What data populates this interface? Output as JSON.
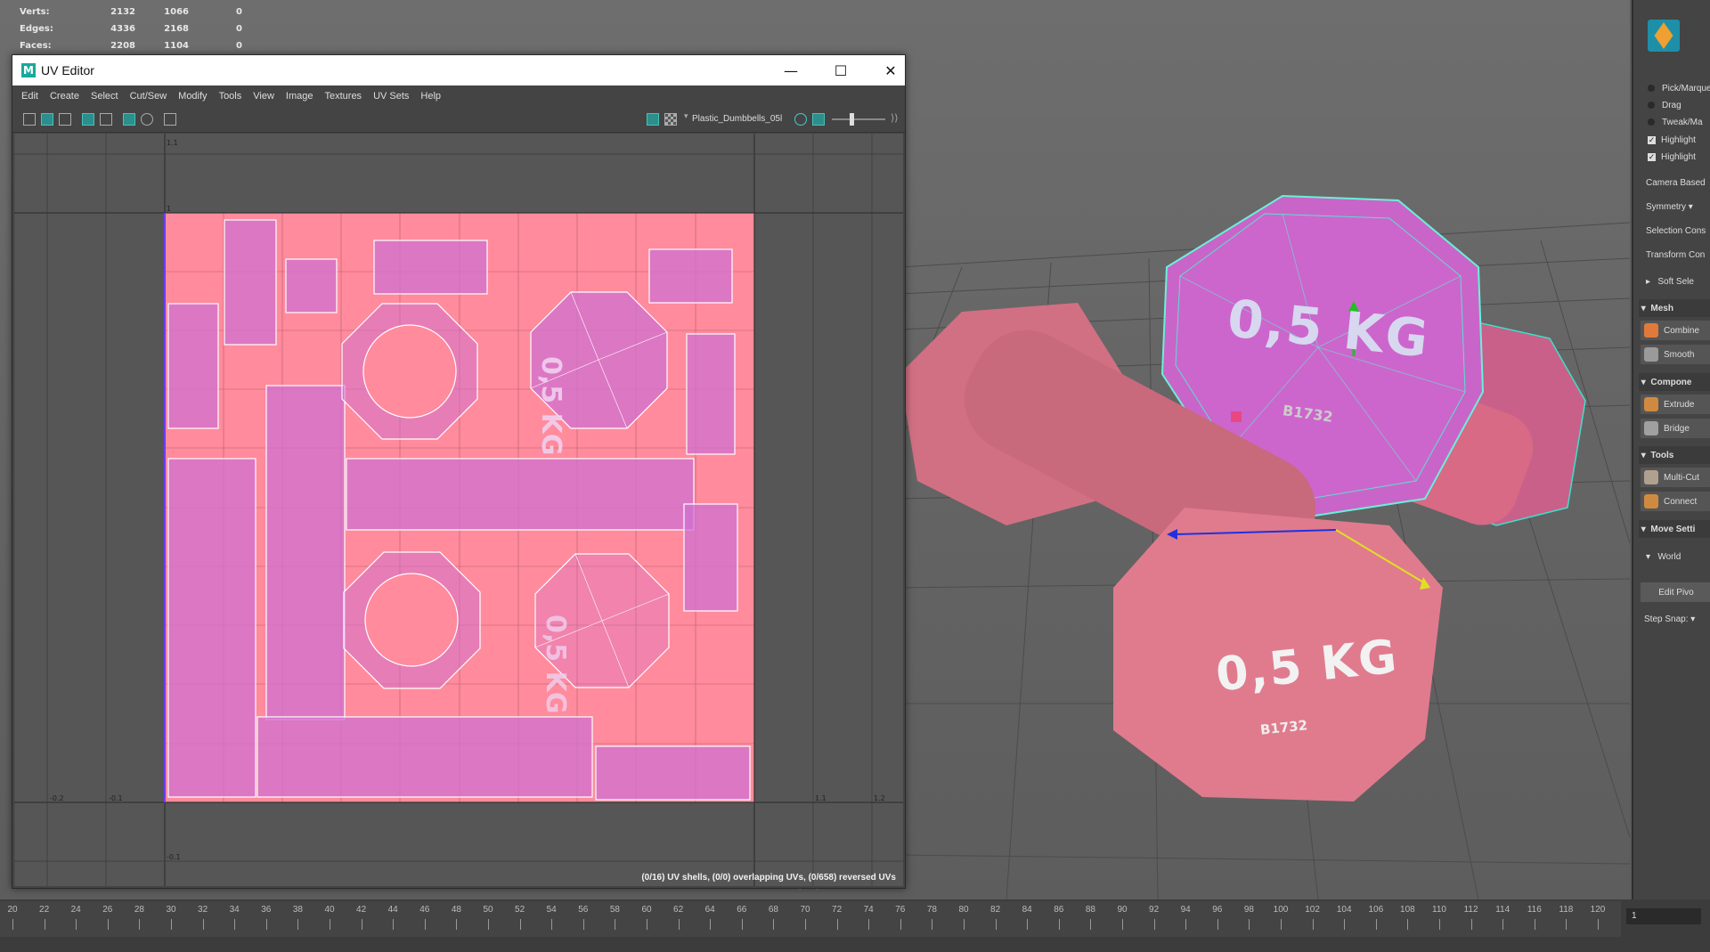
{
  "stats": [
    {
      "label": "Verts:",
      "a": "2132",
      "b": "1066",
      "c": "0"
    },
    {
      "label": "Edges:",
      "a": "4336",
      "b": "2168",
      "c": "0"
    },
    {
      "label": "Faces:",
      "a": "2208",
      "b": "1104",
      "c": "0"
    }
  ],
  "uv_editor": {
    "title": "UV Editor",
    "logo": "M",
    "window_buttons": {
      "minimize": "—",
      "maximize": "☐",
      "close": "✕"
    },
    "menu": [
      "Edit",
      "Create",
      "Select",
      "Cut/Sew",
      "Modify",
      "Tools",
      "View",
      "Image",
      "Textures",
      "UV Sets",
      "Help"
    ],
    "texture_name": "Plastic_Dumbbells_05l",
    "status": "(0/16) UV shells, (0/0) overlapping UVs, (0/658) reversed UVs",
    "axis_labels": {
      "top": "1.1",
      "one": "1",
      "neg02": "-0.2",
      "neg01": "-0.1",
      "p11": "1.1",
      "p12": "1.2",
      "bottom": "-0.1"
    },
    "uv_texts": {
      "weight": "0,5 KG",
      "code": "B1732"
    }
  },
  "viewport": {
    "camera": "persp",
    "dumbbell_label": "0,5 KG",
    "dumbbell_code": "B1732"
  },
  "right_panel": {
    "radios": [
      "Pick/Marquee",
      "Drag",
      "Tweak/Ma"
    ],
    "checks": [
      "Highlight",
      "Highlight"
    ],
    "labels": [
      "Camera Based",
      "Symmetry",
      "Selection Cons",
      "Transform Con",
      "Soft Sele"
    ],
    "sections": {
      "mesh": "Mesh",
      "component": "Compone",
      "tools": "Tools",
      "move": "Move Setti"
    },
    "mesh_tools": [
      "Combine",
      "Smooth"
    ],
    "component_tools": [
      "Extrude",
      "Bridge"
    ],
    "tools": [
      "Multi-Cut",
      "Connect"
    ],
    "world": "World",
    "edit_pivot": "Edit Pivo",
    "step_snap": "Step Snap:"
  },
  "timeline": {
    "ticks": [
      "20",
      "22",
      "24",
      "26",
      "28",
      "30",
      "32",
      "34",
      "36",
      "38",
      "40",
      "42",
      "44",
      "46",
      "48",
      "50",
      "52",
      "54",
      "56",
      "58",
      "60",
      "62",
      "64",
      "66",
      "68",
      "70",
      "72",
      "74",
      "76",
      "78",
      "80",
      "82",
      "84",
      "86",
      "88",
      "90",
      "92",
      "94",
      "96",
      "98",
      "100",
      "102",
      "104",
      "106",
      "108",
      "110",
      "112",
      "114",
      "116",
      "118",
      "120"
    ],
    "current_frame": "1"
  },
  "colors": {
    "accent": "#2c8f8c",
    "uv_bg": "#ff8a9c",
    "uv_shell": "#d072d4",
    "dumbbell": "#e47d8f"
  }
}
